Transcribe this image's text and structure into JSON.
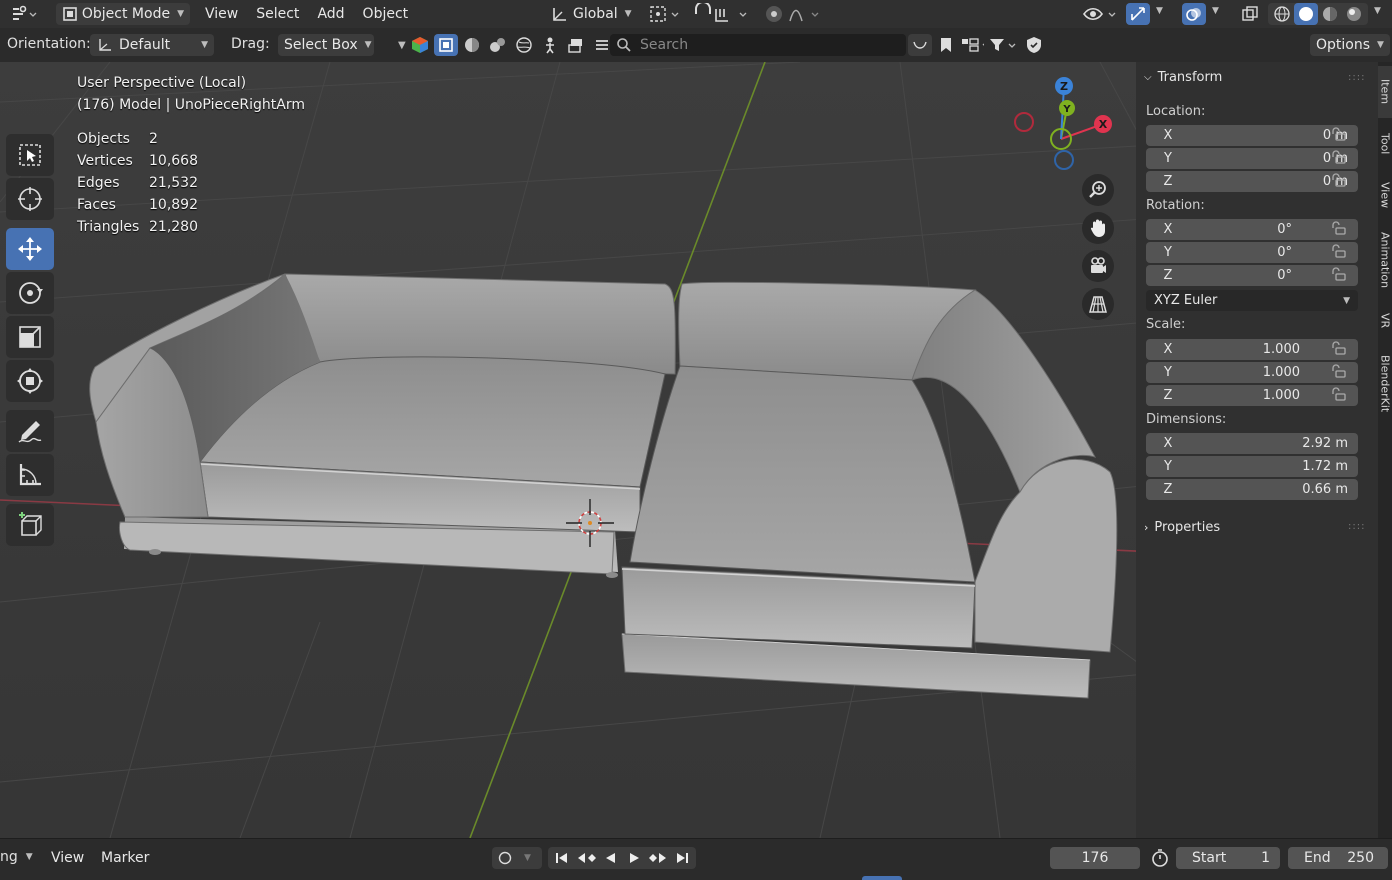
{
  "header": {
    "mode": "Object Mode",
    "menus": [
      "View",
      "Select",
      "Add",
      "Object"
    ],
    "transform_orientation": "Global"
  },
  "tool_header": {
    "orientation_label": "Orientation:",
    "orientation_value": "Default",
    "drag_label": "Drag:",
    "drag_value": "Select Box",
    "search_placeholder": "Search",
    "options_label": "Options"
  },
  "viewport": {
    "view_name": "User Perspective (Local)",
    "object_info": "(176) Model | UnoPieceRightArm",
    "stats": [
      {
        "label": "Objects",
        "value": "2"
      },
      {
        "label": "Vertices",
        "value": "10,668"
      },
      {
        "label": "Edges",
        "value": "21,532"
      },
      {
        "label": "Faces",
        "value": "10,892"
      },
      {
        "label": "Triangles",
        "value": "21,280"
      }
    ],
    "gizmo": {
      "x": "X",
      "y": "Y",
      "z": "Z"
    }
  },
  "npanel": {
    "transform_title": "Transform",
    "location_label": "Location:",
    "location": [
      {
        "axis": "X",
        "value": "0 m"
      },
      {
        "axis": "Y",
        "value": "0 m"
      },
      {
        "axis": "Z",
        "value": "0 m"
      }
    ],
    "rotation_label": "Rotation:",
    "rotation": [
      {
        "axis": "X",
        "value": "0°"
      },
      {
        "axis": "Y",
        "value": "0°"
      },
      {
        "axis": "Z",
        "value": "0°"
      }
    ],
    "rotation_mode": "XYZ Euler",
    "scale_label": "Scale:",
    "scale": [
      {
        "axis": "X",
        "value": "1.000"
      },
      {
        "axis": "Y",
        "value": "1.000"
      },
      {
        "axis": "Z",
        "value": "1.000"
      }
    ],
    "dimensions_label": "Dimensions:",
    "dimensions": [
      {
        "axis": "X",
        "value": "2.92 m"
      },
      {
        "axis": "Y",
        "value": "1.72 m"
      },
      {
        "axis": "Z",
        "value": "0.66 m"
      }
    ],
    "properties_title": "Properties",
    "tabs": [
      "Item",
      "Tool",
      "View",
      "Animation",
      "VR",
      "BlenderKit"
    ]
  },
  "timeline": {
    "editor_menu": "ng",
    "menus": [
      "View",
      "Marker"
    ],
    "current_frame": "176",
    "start_label": "Start",
    "start_value": "1",
    "end_label": "End",
    "end_value": "250"
  },
  "colors": {
    "accent": "#4772b3",
    "axis_x": "#e0344f",
    "axis_y": "#7fb120",
    "axis_z": "#3b83d8"
  }
}
